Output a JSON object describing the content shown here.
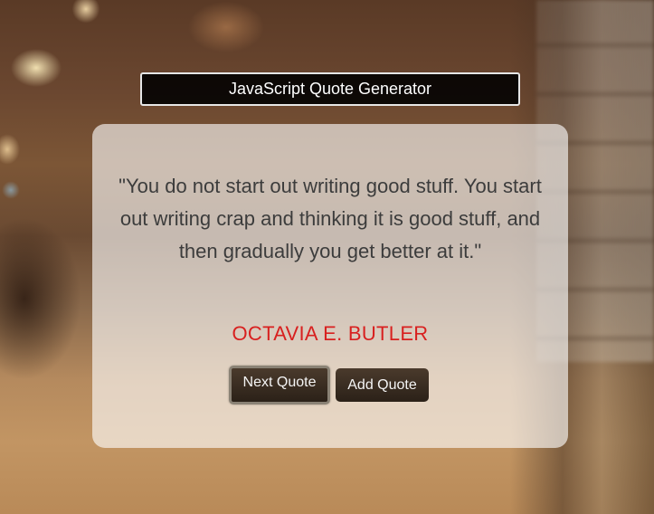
{
  "header": {
    "title": "JavaScript Quote Generator"
  },
  "quote": {
    "text": "\"You do not start out writing good stuff. You start out writing crap and thinking it is good stuff, and then gradually you get better at it.\"",
    "author": "OCTAVIA E. BUTLER"
  },
  "buttons": {
    "next_label": "Next Quote",
    "add_label": "Add Quote"
  },
  "colors": {
    "author": "#d8201f",
    "title_bg": "#000000",
    "button_bg": "#2b2118",
    "card_bg": "rgba(255,255,255,0.62)"
  }
}
